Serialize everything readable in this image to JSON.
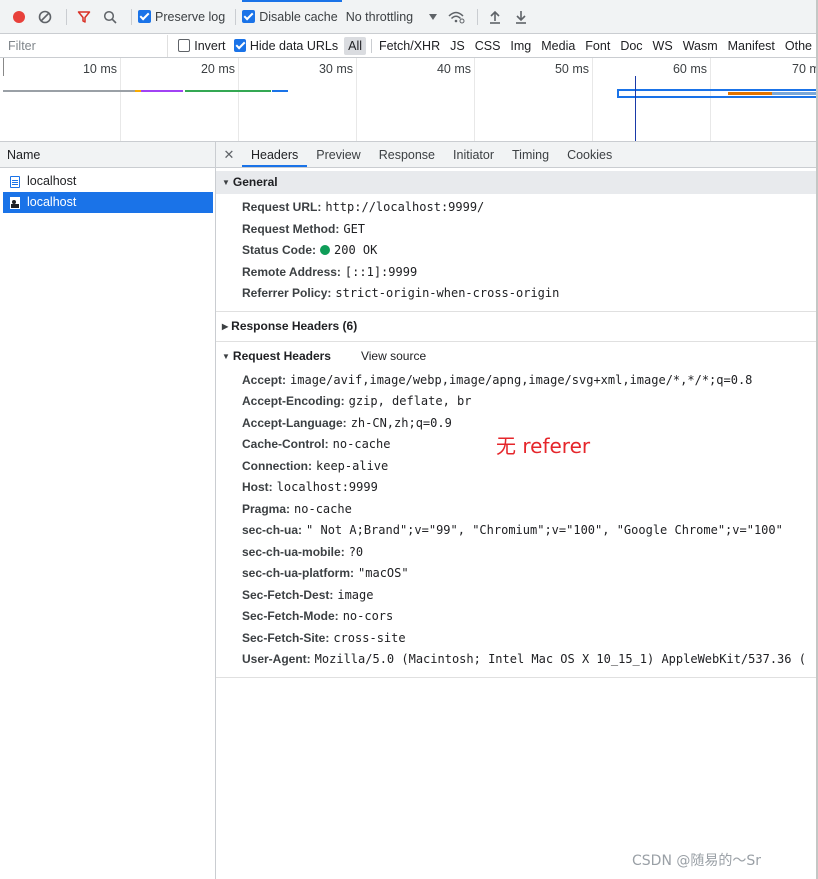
{
  "toolbar": {
    "preserve_log": "Preserve log",
    "disable_cache": "Disable cache",
    "throttling": "No throttling"
  },
  "filterbar": {
    "filter_placeholder": "Filter",
    "invert": "Invert",
    "hide_data_urls": "Hide data URLs",
    "types": [
      "All",
      "Fetch/XHR",
      "JS",
      "CSS",
      "Img",
      "Media",
      "Font",
      "Doc",
      "WS",
      "Wasm",
      "Manifest",
      "Othe"
    ]
  },
  "overview": {
    "ticks": [
      "10 ms",
      "20 ms",
      "30 ms",
      "40 ms",
      "50 ms",
      "60 ms",
      "70 m"
    ]
  },
  "requests": {
    "header": "Name",
    "items": [
      "localhost",
      "localhost"
    ]
  },
  "tabs": [
    "Headers",
    "Preview",
    "Response",
    "Initiator",
    "Timing",
    "Cookies"
  ],
  "general": {
    "title": "General",
    "rows": [
      {
        "k": "Request URL:",
        "v": "http://localhost:9999/"
      },
      {
        "k": "Request Method:",
        "v": "GET"
      },
      {
        "k": "Status Code:",
        "v": "200 OK"
      },
      {
        "k": "Remote Address:",
        "v": "[::1]:9999"
      },
      {
        "k": "Referrer Policy:",
        "v": "strict-origin-when-cross-origin"
      }
    ]
  },
  "response_headers": {
    "title": "Response Headers (6)"
  },
  "request_headers": {
    "title": "Request Headers",
    "view_source": "View source",
    "rows": [
      {
        "k": "Accept:",
        "v": "image/avif,image/webp,image/apng,image/svg+xml,image/*,*/*;q=0.8"
      },
      {
        "k": "Accept-Encoding:",
        "v": "gzip, deflate, br"
      },
      {
        "k": "Accept-Language:",
        "v": "zh-CN,zh;q=0.9"
      },
      {
        "k": "Cache-Control:",
        "v": "no-cache"
      },
      {
        "k": "Connection:",
        "v": "keep-alive"
      },
      {
        "k": "Host:",
        "v": "localhost:9999"
      },
      {
        "k": "Pragma:",
        "v": "no-cache"
      },
      {
        "k": "sec-ch-ua:",
        "v": "\" Not A;Brand\";v=\"99\", \"Chromium\";v=\"100\", \"Google Chrome\";v=\"100\""
      },
      {
        "k": "sec-ch-ua-mobile:",
        "v": "?0"
      },
      {
        "k": "sec-ch-ua-platform:",
        "v": "\"macOS\""
      },
      {
        "k": "Sec-Fetch-Dest:",
        "v": "image"
      },
      {
        "k": "Sec-Fetch-Mode:",
        "v": "no-cors"
      },
      {
        "k": "Sec-Fetch-Site:",
        "v": "cross-site"
      },
      {
        "k": "User-Agent:",
        "v": "Mozilla/5.0 (Macintosh; Intel Mac OS X 10_15_1) AppleWebKit/537.36 ("
      }
    ]
  },
  "annotation": "无 referer",
  "watermark": "CSDN @随易的～Sr",
  "colors": {
    "accent": "#1a73e8",
    "record": "#e8403a",
    "status_ok": "#0f9d58",
    "annotation": "#e5262b"
  }
}
